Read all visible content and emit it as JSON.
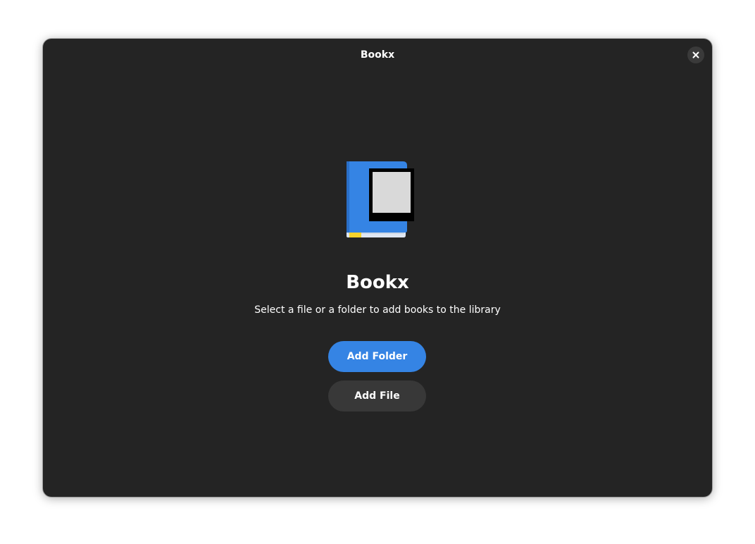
{
  "window": {
    "title": "Bookx"
  },
  "status_page": {
    "icon": "book-reader-icon",
    "title": "Bookx",
    "description": "Select a file or a folder to add books to the library"
  },
  "actions": {
    "add_folder_label": "Add Folder",
    "add_file_label": "Add File"
  },
  "colors": {
    "window_bg": "#242424",
    "accent": "#3584e4",
    "button_bg": "#383838",
    "close_button_bg": "#3a3a3a",
    "text": "#ffffff"
  }
}
